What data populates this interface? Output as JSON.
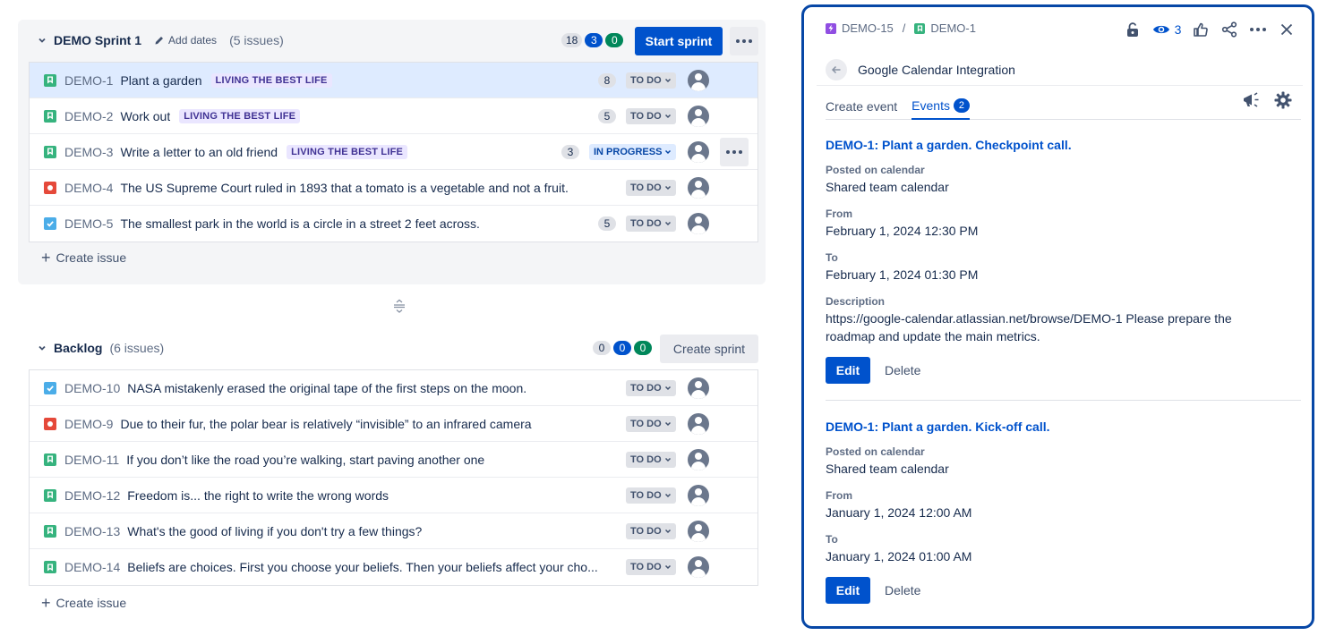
{
  "sprint": {
    "title": "DEMO Sprint 1",
    "add_dates_label": "Add dates",
    "issue_count": "(5 issues)",
    "counts": {
      "todo": "18",
      "in_progress": "3",
      "done": "0"
    },
    "start_sprint_label": "Start sprint",
    "issues": [
      {
        "type": "story",
        "key": "DEMO-1",
        "summary": "Plant a garden",
        "epic": "LIVING THE BEST LIFE",
        "estimate": "8",
        "status": "TO DO"
      },
      {
        "type": "story",
        "key": "DEMO-2",
        "summary": "Work out",
        "epic": "LIVING THE BEST LIFE",
        "estimate": "5",
        "status": "TO DO"
      },
      {
        "type": "story",
        "key": "DEMO-3",
        "summary": "Write a letter to an old friend",
        "epic": "LIVING THE BEST LIFE",
        "estimate": "3",
        "status": "IN PROGRESS"
      },
      {
        "type": "bug",
        "key": "DEMO-4",
        "summary": "The US Supreme Court ruled in 1893 that a tomato is a vegetable and not a fruit.",
        "status": "TO DO"
      },
      {
        "type": "task",
        "key": "DEMO-5",
        "summary": "The smallest park in the world is a circle in a street 2 feet across.",
        "estimate": "5",
        "status": "TO DO"
      }
    ],
    "create_issue_label": "Create issue"
  },
  "backlog": {
    "title": "Backlog",
    "issue_count": "(6 issues)",
    "counts": {
      "todo": "0",
      "in_progress": "0",
      "done": "0"
    },
    "create_sprint_label": "Create sprint",
    "issues": [
      {
        "type": "task",
        "key": "DEMO-10",
        "summary": "NASA mistakenly erased the original tape of the first steps on the moon.",
        "status": "TO DO"
      },
      {
        "type": "bug",
        "key": "DEMO-9",
        "summary": "Due to their fur, the polar bear is relatively “invisible” to an infrared camera",
        "status": "TO DO"
      },
      {
        "type": "story",
        "key": "DEMO-11",
        "summary": "If you don’t like the road you’re walking, start paving another one",
        "status": "TO DO"
      },
      {
        "type": "story",
        "key": "DEMO-12",
        "summary": "Freedom is... the right to write the wrong words",
        "status": "TO DO"
      },
      {
        "type": "story",
        "key": "DEMO-13",
        "summary": "What's the good of living if you don't try a few things?",
        "status": "TO DO"
      },
      {
        "type": "story",
        "key": "DEMO-14",
        "summary": "Beliefs are choices. First you choose your beliefs. Then your beliefs affect your cho...",
        "status": "TO DO"
      }
    ],
    "create_issue_label": "Create issue"
  },
  "detail": {
    "breadcrumb": {
      "parent": "DEMO-15",
      "current": "DEMO-1"
    },
    "watchers": "3",
    "app_title": "Google Calendar Integration",
    "tabs": {
      "create": "Create event",
      "events": "Events",
      "events_count": "2"
    },
    "events": [
      {
        "title": "DEMO-1: Plant a garden. Checkpoint call.",
        "calendar_label": "Posted on calendar",
        "calendar": "Shared team calendar",
        "from_label": "From",
        "from": "February 1, 2024 12:30 PM",
        "to_label": "To",
        "to": "February 1, 2024 01:30 PM",
        "description_label": "Description",
        "description": "https://google-calendar.atlassian.net/browse/DEMO-1 Please prepare the roadmap and update the main metrics.",
        "edit_label": "Edit",
        "delete_label": "Delete"
      },
      {
        "title": "DEMO-1: Plant a garden. Kick-off call.",
        "calendar_label": "Posted on calendar",
        "calendar": "Shared team calendar",
        "from_label": "From",
        "from": "January 1, 2024 12:00 AM",
        "to_label": "To",
        "to": "January 1, 2024 01:00 AM",
        "edit_label": "Edit",
        "delete_label": "Delete"
      }
    ]
  },
  "colors": {
    "primary": "#0052cc",
    "story": "#36b37e",
    "bug": "#e5493a",
    "task": "#4bade8",
    "epic": "#904ee2",
    "selected_row": "#deebff",
    "panel_border": "#0747a6"
  },
  "icons": {
    "story": "bookmark-icon",
    "bug": "bug-dot-icon",
    "task": "checkbox-icon",
    "epic": "lightning-icon"
  }
}
